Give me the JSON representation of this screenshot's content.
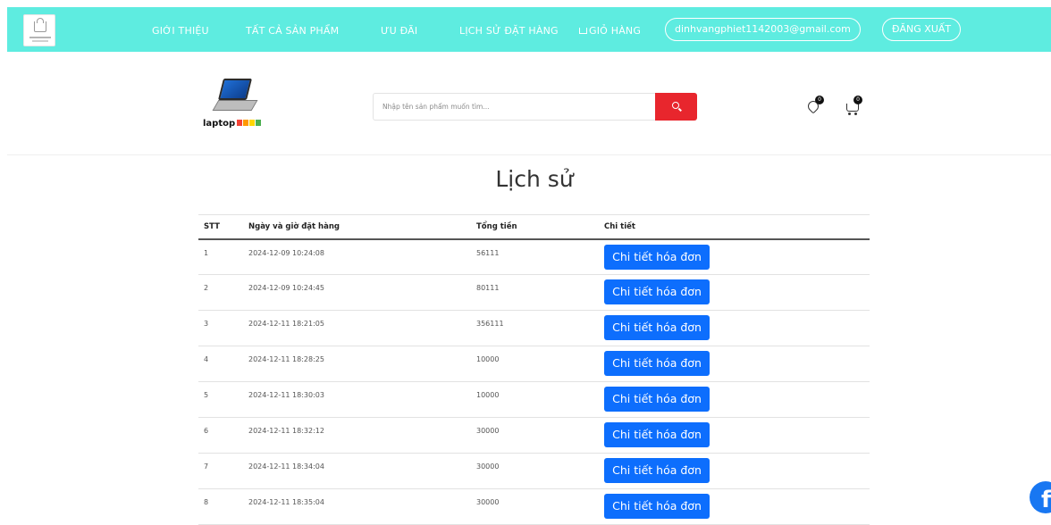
{
  "nav": {
    "links": [
      "GIỚI THIỆU",
      "TẤT CẢ SẢN PHẨM",
      "ƯU ĐÃI",
      "LỊCH SỬ ĐẶT HÀNG",
      "GIỎ HÀNG"
    ],
    "email": "dinhvangphiet1142003@gmail.com",
    "logout": "ĐĂNG XUẤT",
    "accent": "#5eece0"
  },
  "header": {
    "logo_text": "laptop",
    "search_placeholder": "Nhập tên sản phẩm muốn tìm...",
    "wishlist_count": "0",
    "cart_count": "0",
    "search_color": "#e8262d"
  },
  "page": {
    "title": "Lịch sử"
  },
  "table": {
    "headers": [
      "STT",
      "Ngày và giờ đặt hàng",
      "Tổng tiền",
      "Chi tiết"
    ],
    "rows": [
      {
        "stt": "1",
        "date": "2024-12-09 10:24:08",
        "total": "56111",
        "action": "Chi tiết hóa đơn"
      },
      {
        "stt": "2",
        "date": "2024-12-09 10:24:45",
        "total": "80111",
        "action": "Chi tiết hóa đơn"
      },
      {
        "stt": "3",
        "date": "2024-12-11 18:21:05",
        "total": "356111",
        "action": "Chi tiết hóa đơn"
      },
      {
        "stt": "4",
        "date": "2024-12-11 18:28:25",
        "total": "10000",
        "action": "Chi tiết hóa đơn"
      },
      {
        "stt": "5",
        "date": "2024-12-11 18:30:03",
        "total": "10000",
        "action": "Chi tiết hóa đơn"
      },
      {
        "stt": "6",
        "date": "2024-12-11 18:32:12",
        "total": "30000",
        "action": "Chi tiết hóa đơn"
      },
      {
        "stt": "7",
        "date": "2024-12-11 18:34:04",
        "total": "30000",
        "action": "Chi tiết hóa đơn"
      },
      {
        "stt": "8",
        "date": "2024-12-11 18:35:04",
        "total": "30000",
        "action": "Chi tiết hóa đơn"
      }
    ],
    "button_color": "#0d6efd"
  },
  "icons": [
    "bag-icon",
    "cart-icon",
    "search-icon",
    "heart-icon",
    "facebook-icon"
  ]
}
